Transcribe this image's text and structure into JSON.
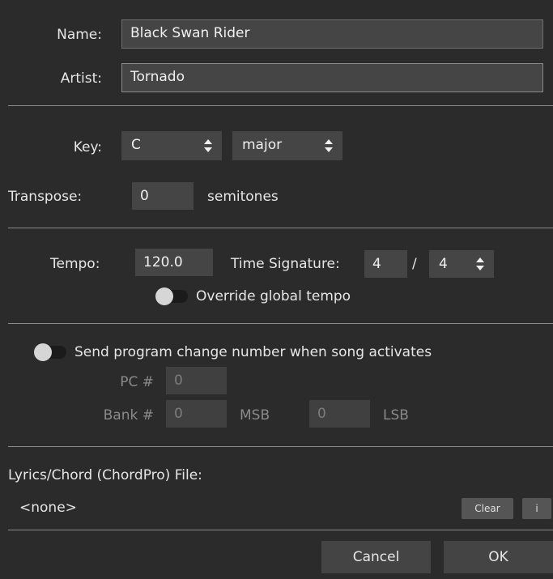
{
  "song": {
    "name_label": "Name:",
    "name_value": "Black Swan Rider",
    "artist_label": "Artist:",
    "artist_value": "Tornado"
  },
  "key": {
    "label": "Key:",
    "note": "C",
    "mode": "major"
  },
  "transpose": {
    "label": "Transpose:",
    "value": "0",
    "unit": "semitones"
  },
  "tempo": {
    "label": "Tempo:",
    "value": "120.0",
    "time_sig_label": "Time Signature:",
    "numerator": "4",
    "slash": "/",
    "denominator": "4",
    "override_label": "Override global tempo"
  },
  "program_change": {
    "toggle_label": "Send program change number when song activates",
    "pc_label": "PC #",
    "pc_value": "0",
    "bank_label": "Bank #",
    "msb_value": "0",
    "msb_label": "MSB",
    "lsb_value": "0",
    "lsb_label": "LSB"
  },
  "lyrics": {
    "label": "Lyrics/Chord (ChordPro) File:",
    "file": "<none>",
    "clear_label": "Clear",
    "info_label": "i"
  },
  "footer": {
    "cancel_label": "Cancel",
    "ok_label": "OK"
  }
}
